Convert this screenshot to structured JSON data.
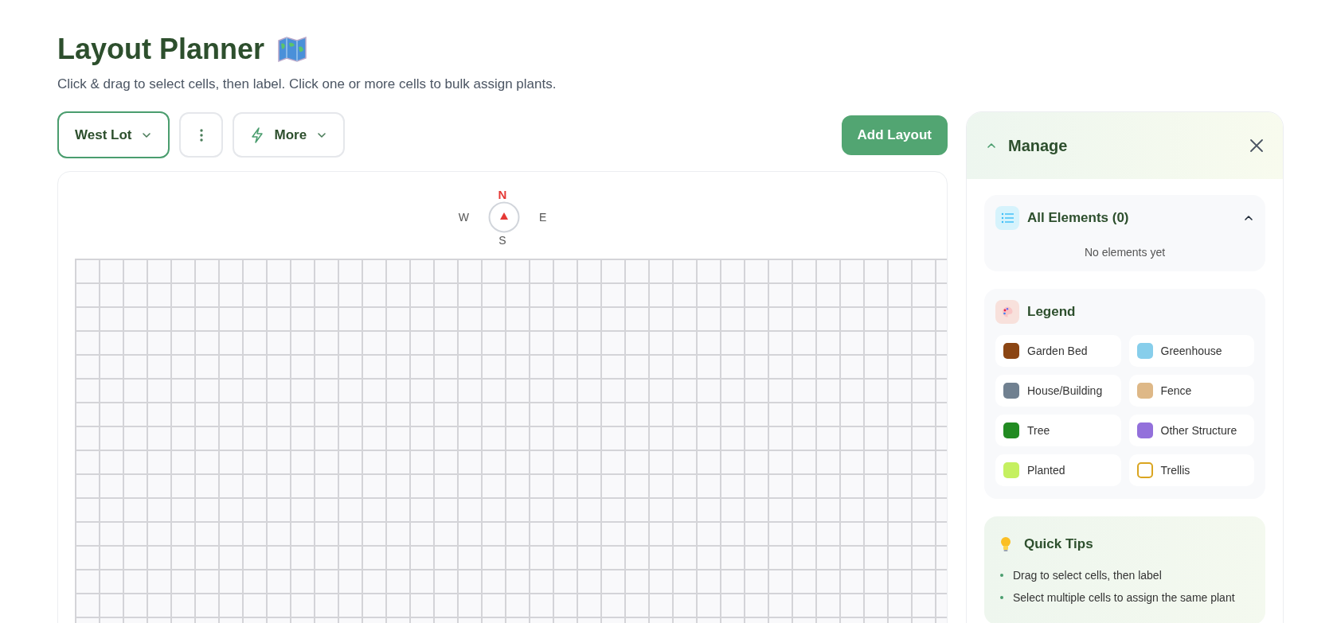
{
  "page": {
    "title": "Layout Planner",
    "subtitle": "Click & drag to select cells, then label. Click one or more cells to bulk assign plants."
  },
  "toolbar": {
    "layout_select": {
      "value": "West Lot"
    },
    "more_button": {
      "label": "More"
    },
    "add_button": {
      "label": "Add Layout"
    }
  },
  "compass": {
    "north": "N",
    "west": "W",
    "east": "E",
    "south": "S"
  },
  "manage_panel": {
    "title": "Manage",
    "expanded": true,
    "all_elements": {
      "title": "All Elements (0)",
      "expanded": true,
      "empty_text": "No elements yet"
    },
    "legend": {
      "title": "Legend",
      "items": [
        {
          "label": "Garden Bed",
          "color": "#8b4513",
          "kind": "fill"
        },
        {
          "label": "Greenhouse",
          "color": "#87ceeb",
          "kind": "fill"
        },
        {
          "label": "House/Building",
          "color": "#708090",
          "kind": "fill"
        },
        {
          "label": "Fence",
          "color": "#deb887",
          "kind": "fill"
        },
        {
          "label": "Tree",
          "color": "#228b22",
          "kind": "fill"
        },
        {
          "label": "Other Structure",
          "color": "#9370db",
          "kind": "fill"
        },
        {
          "label": "Planted",
          "color": "#c5f060",
          "kind": "fill"
        },
        {
          "label": "Trellis",
          "color": "#daa520",
          "kind": "outline"
        }
      ]
    },
    "quick_tips": {
      "title": "Quick Tips",
      "items": [
        "Drag to select cells, then label",
        "Select multiple cells to assign the same plant"
      ]
    }
  }
}
